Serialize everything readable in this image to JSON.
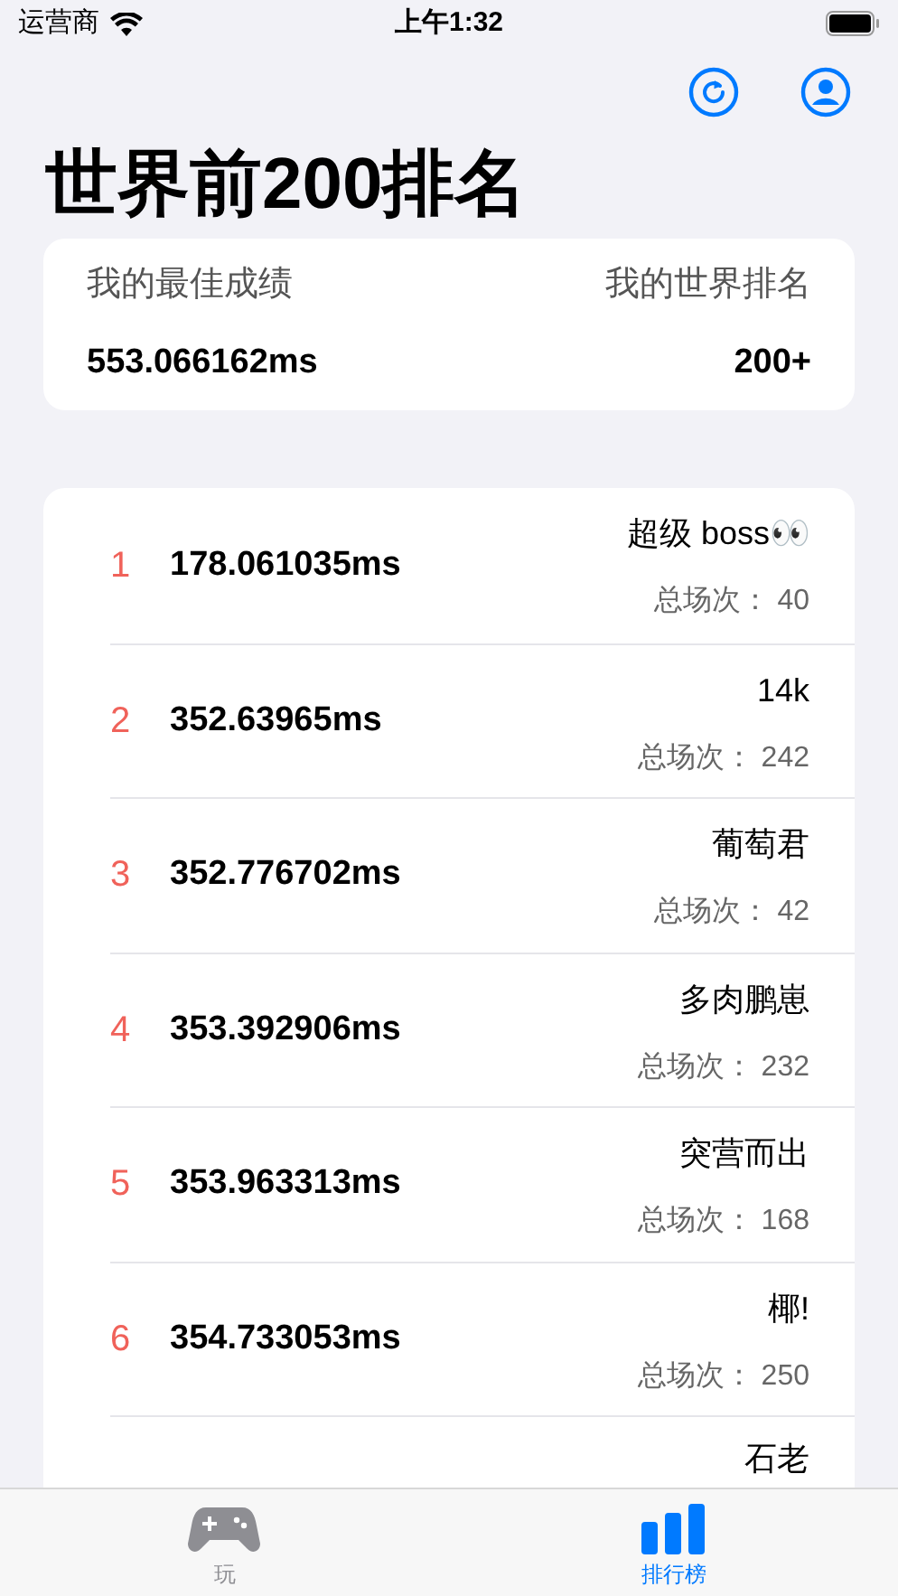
{
  "status_bar": {
    "carrier": "运营商",
    "time": "上午1:32"
  },
  "title": "世界前200排名",
  "summary": {
    "best_label": "我的最佳成绩",
    "rank_label": "我的世界排名",
    "best_value": "553.066162ms",
    "rank_value": "200+"
  },
  "rows": [
    {
      "rank": "1",
      "score": "178.061035ms",
      "name": "超级 boss👀",
      "games": "总场次： 40"
    },
    {
      "rank": "2",
      "score": "352.63965ms",
      "name": "14k",
      "games": "总场次： 242"
    },
    {
      "rank": "3",
      "score": "352.776702ms",
      "name": "葡萄君",
      "games": "总场次： 42"
    },
    {
      "rank": "4",
      "score": "353.392906ms",
      "name": "多肉鹏崽",
      "games": "总场次： 232"
    },
    {
      "rank": "5",
      "score": "353.963313ms",
      "name": "突营而出",
      "games": "总场次： 168"
    },
    {
      "rank": "6",
      "score": "354.733053ms",
      "name": "椰!",
      "games": "总场次： 250"
    },
    {
      "name": "石老"
    }
  ],
  "tabs": [
    {
      "label": "玩",
      "kind": "play",
      "selected": false
    },
    {
      "label": "排行榜",
      "kind": "rank",
      "selected": true
    }
  ]
}
